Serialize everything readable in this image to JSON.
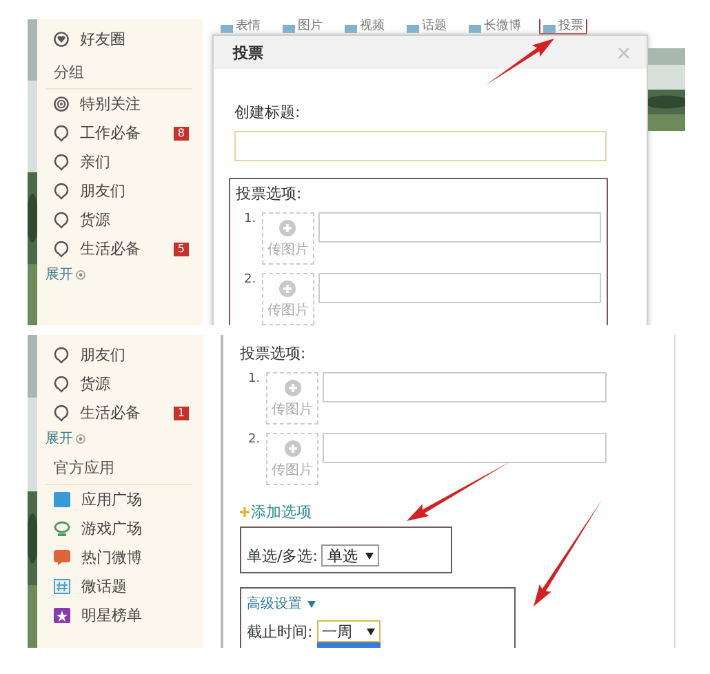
{
  "top_screenshot": {
    "toolbar": [
      {
        "label": "表情",
        "selected": false
      },
      {
        "label": "图片",
        "selected": false
      },
      {
        "label": "视频",
        "selected": false
      },
      {
        "label": "话题",
        "selected": false
      },
      {
        "label": "长微博",
        "selected": false
      },
      {
        "label": "投票",
        "selected": true
      }
    ],
    "sidebar": [
      {
        "kind": "circle-link",
        "label": "好友圈"
      },
      {
        "kind": "heading",
        "label": "分组"
      },
      {
        "kind": "special",
        "label": "特别关注"
      },
      {
        "kind": "group",
        "label": "工作必备",
        "badge": "8"
      },
      {
        "kind": "group",
        "label": "亲们"
      },
      {
        "kind": "group",
        "label": "朋友们"
      },
      {
        "kind": "group",
        "label": "货源"
      },
      {
        "kind": "group",
        "label": "生活必备",
        "badge": "5"
      },
      {
        "kind": "expand",
        "label": "展开"
      }
    ],
    "dialog": {
      "title": "投票",
      "title_label": "创建标题:",
      "options_label": "投票选项:",
      "options": [
        {
          "number": "1.",
          "upload": "传图片"
        },
        {
          "number": "2.",
          "upload": "传图片"
        }
      ]
    }
  },
  "bottom_screenshot": {
    "sidebar": [
      {
        "kind": "group",
        "label": "朋友们"
      },
      {
        "kind": "group",
        "label": "货源"
      },
      {
        "kind": "group",
        "label": "生活必备",
        "badge": "1"
      },
      {
        "kind": "expand",
        "label": "展开"
      },
      {
        "kind": "heading",
        "label": "官方应用"
      },
      {
        "kind": "app-store",
        "label": "应用广场"
      },
      {
        "kind": "game",
        "label": "游戏广场"
      },
      {
        "kind": "hot",
        "label": "热门微博"
      },
      {
        "kind": "topic",
        "label": "微话题"
      },
      {
        "kind": "star",
        "label": "明星榜单"
      }
    ],
    "dialog": {
      "options_label": "投票选项:",
      "options": [
        {
          "number": "1.",
          "upload": "传图片"
        },
        {
          "number": "2.",
          "upload": "传图片"
        }
      ],
      "add_option": "添加选项",
      "choice": {
        "label": "单选/多选:",
        "value": "单选"
      },
      "advanced": {
        "label": "高级设置",
        "expanded": true,
        "deadline_label": "截止时间:",
        "deadline_value": "一周",
        "dropdown_open": true
      }
    }
  }
}
